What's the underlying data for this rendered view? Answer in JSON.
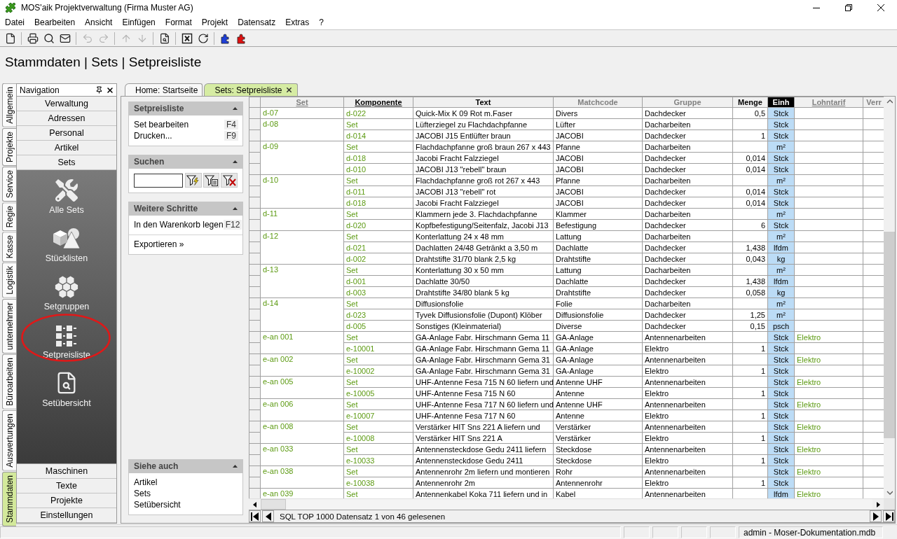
{
  "window": {
    "title": "MOS'aik Projektverwaltung (Firma Muster AG)"
  },
  "menu": [
    "Datei",
    "Bearbeiten",
    "Ansicht",
    "Einfügen",
    "Format",
    "Projekt",
    "Datensatz",
    "Extras",
    "?"
  ],
  "toolbar": [
    [
      {
        "disabled": false
      }
    ],
    [
      {
        "disabled": false
      },
      {
        "disabled": false
      },
      {
        "disabled": false
      }
    ],
    [
      {
        "disabled": true
      },
      {
        "disabled": true
      }
    ],
    [
      {
        "disabled": true
      },
      {
        "disabled": true
      }
    ],
    [
      {
        "disabled": false
      }
    ],
    [
      {
        "disabled": false
      },
      {
        "disabled": false
      }
    ],
    [
      {
        "disabled": false
      },
      {
        "disabled": false
      }
    ]
  ],
  "header": {
    "title": "Stammdaten | Sets | Setpreisliste"
  },
  "side_tabs": [
    {
      "label": "Allgemein",
      "selected": false
    },
    {
      "label": "Projekte",
      "selected": false
    },
    {
      "label": "Service",
      "selected": false
    },
    {
      "label": "Regie",
      "selected": false
    },
    {
      "label": "Kasse",
      "selected": false
    },
    {
      "label": "Logistik",
      "selected": false
    },
    {
      "label": "unternehmer",
      "selected": false
    },
    {
      "label": "Büroarbeiten",
      "selected": false
    },
    {
      "label": "Auswertungen",
      "selected": false
    },
    {
      "label": "Stammdaten",
      "selected": true
    }
  ],
  "navigation": {
    "title": "Navigation",
    "top_buttons": [
      "Verwaltung",
      "Adressen",
      "Personal",
      "Artikel",
      "Sets"
    ],
    "tiles": [
      {
        "label": "Alle Sets",
        "highlighted": false
      },
      {
        "label": "Stücklisten",
        "highlighted": false
      },
      {
        "label": "Setgruppen",
        "highlighted": false
      },
      {
        "label": "Setpreisliste",
        "highlighted": true
      },
      {
        "label": "Setübersicht",
        "highlighted": false
      }
    ],
    "bottom_buttons": [
      "Maschinen",
      "Texte",
      "Projekte",
      "Einstellungen"
    ]
  },
  "document_tabs": [
    {
      "label": "Home: Startseite",
      "selected": false,
      "closable": false
    },
    {
      "label": "Sets: Setpreisliste",
      "selected": true,
      "closable": true
    }
  ],
  "task_panel": {
    "sections": [
      {
        "kind": "links",
        "title": "Setpreisliste",
        "expanded": true,
        "groups": [
          [
            {
              "label": "Set bearbeiten",
              "shortcut": "F4"
            },
            {
              "label": "Drucken...",
              "shortcut": "F9"
            }
          ]
        ]
      },
      {
        "kind": "search",
        "title": "Suchen",
        "expanded": true
      },
      {
        "kind": "links",
        "title": "Weitere Schritte",
        "expanded": true,
        "groups": [
          [
            {
              "label": "In den Warenkorb legen",
              "shortcut": "F12"
            }
          ],
          [
            {
              "label": "Exportieren »"
            }
          ]
        ]
      }
    ],
    "see_also": {
      "kind": "links",
      "title": "Siehe auch",
      "expanded": true,
      "groups": [
        [
          {
            "label": "Artikel"
          },
          {
            "label": "Sets"
          },
          {
            "label": "Setübersicht"
          }
        ]
      ]
    }
  },
  "grid": {
    "columns": [
      {
        "label": "Set",
        "underlined": true,
        "dimmed": true,
        "selected": false
      },
      {
        "label": "Komponente",
        "underlined": true,
        "dimmed": false,
        "selected": false
      },
      {
        "label": "Text",
        "underlined": false,
        "dimmed": false,
        "selected": false
      },
      {
        "label": "Matchcode",
        "underlined": false,
        "dimmed": true,
        "selected": false
      },
      {
        "label": "Gruppe",
        "underlined": false,
        "dimmed": true,
        "selected": false
      },
      {
        "label": "Menge",
        "underlined": false,
        "dimmed": false,
        "selected": false
      },
      {
        "label": "Einh",
        "underlined": false,
        "dimmed": false,
        "selected": true
      },
      {
        "label": "Lohntarif",
        "underlined": true,
        "dimmed": true,
        "selected": false
      },
      {
        "label": "Verr",
        "underlined": false,
        "dimmed": true,
        "selected": false
      }
    ],
    "groups": [
      {
        "set": "d-07",
        "rows": [
          {
            "component": "d-022",
            "text": "Quick-Mix K 09 Rot m.Faser",
            "matchcode": "Divers",
            "group": "Dachdecker",
            "quantity": "0,5",
            "unit": "Stck"
          }
        ]
      },
      {
        "set": "d-08",
        "rows": [
          {
            "component": "Set",
            "text": "Lüfterziegel zu Flachdachpfanne",
            "matchcode": "Lüfter",
            "group": "Dacharbeiten",
            "unit": "Stck"
          },
          {
            "component": "d-014",
            "text": "JACOBI J15 Entlüfter braun",
            "matchcode": "JACOBI",
            "group": "Dachdecker",
            "quantity": "1",
            "unit": "Stck"
          }
        ]
      },
      {
        "set": "d-09",
        "rows": [
          {
            "component": "Set",
            "text": "Flachdachpfanne groß braun 267 x 443",
            "matchcode": "Pfanne",
            "group": "Dacharbeiten",
            "unit": "m²"
          },
          {
            "component": "d-018",
            "text": "Jacobi Fracht Falzziegel",
            "matchcode": "JACOBI",
            "group": "Dachdecker",
            "quantity": "0,014",
            "unit": "Stck"
          },
          {
            "component": "d-010",
            "text": "JACOBI J13 \"rebell\" braun",
            "matchcode": "JACOBI",
            "group": "Dachdecker",
            "quantity": "0,014",
            "unit": "Stck"
          }
        ]
      },
      {
        "set": "d-10",
        "rows": [
          {
            "component": "Set",
            "text": "Flachdachpfanne groß rot 267 x 443",
            "matchcode": "Pfanne",
            "group": "Dacharbeiten",
            "unit": "m²"
          },
          {
            "component": "d-011",
            "text": "JACOBI J13 \"rebell\" rot",
            "matchcode": "JACOBI",
            "group": "Dachdecker",
            "quantity": "0,014",
            "unit": "Stck"
          },
          {
            "component": "d-018",
            "text": "Jacobi Fracht Falzziegel",
            "matchcode": "JACOBI",
            "group": "Dachdecker",
            "quantity": "0,014",
            "unit": "Stck"
          }
        ]
      },
      {
        "set": "d-11",
        "rows": [
          {
            "component": "Set",
            "text": "Klammern jede 3. Flachdachpfanne",
            "matchcode": "Klammer",
            "group": "Dacharbeiten",
            "unit": "m²"
          },
          {
            "component": "d-020",
            "text": "Kopfbefestigung/Seitenfalz, Jacobi J13",
            "matchcode": "Befestigung",
            "group": "Dachdecker",
            "quantity": "6",
            "unit": "Stck"
          }
        ]
      },
      {
        "set": "d-12",
        "rows": [
          {
            "component": "Set",
            "text": "Konterlattung 24 x 48 mm",
            "matchcode": "Lattung",
            "group": "Dacharbeiten",
            "unit": "m²"
          },
          {
            "component": "d-021",
            "text": "Dachlatten 24/48 Getränkt a 3,50 m",
            "matchcode": "Dachlatte",
            "group": "Dachdecker",
            "quantity": "1,438",
            "unit": "lfdm"
          },
          {
            "component": "d-002",
            "text": "Drahtstifte 31/70 blank 2,5 kg",
            "matchcode": "Drahtstifte",
            "group": "Dachdecker",
            "quantity": "0,043",
            "unit": "kg"
          }
        ]
      },
      {
        "set": "d-13",
        "rows": [
          {
            "component": "Set",
            "text": "Konterlattung 30 x 50 mm",
            "matchcode": "Lattung",
            "group": "Dacharbeiten",
            "unit": "m²"
          },
          {
            "component": "d-001",
            "text": "Dachlatte 30/50",
            "matchcode": "Dachlatte",
            "group": "Dachdecker",
            "quantity": "1,438",
            "unit": "lfdm"
          },
          {
            "component": "d-003",
            "text": "Drahtstifte 34/80 blank 5 kg",
            "matchcode": "Drahtstifte",
            "group": "Dachdecker",
            "quantity": "0,058",
            "unit": "kg"
          }
        ]
      },
      {
        "set": "d-14",
        "rows": [
          {
            "component": "Set",
            "text": "Diffusionsfolie",
            "matchcode": "Folie",
            "group": "Dacharbeiten",
            "unit": "m²"
          },
          {
            "component": "d-023",
            "text": "Tyvek Diffusionsfolie (Dupont) Klöber",
            "matchcode": "Diffusionsfolie",
            "group": "Dachdecker",
            "quantity": "1,25",
            "unit": "m²"
          },
          {
            "component": "d-005",
            "text": "Sonstiges (Kleinmaterial)",
            "matchcode": "Diverse",
            "group": "Dachdecker",
            "quantity": "0,15",
            "unit": "psch"
          }
        ]
      },
      {
        "set": "e-an 001",
        "rows": [
          {
            "component": "Set",
            "text": "GA-Anlage Fabr. Hirschmann Gema 11",
            "matchcode": "GA-Anlage",
            "group": "Antennenarbeiten",
            "unit": "Stck",
            "wage_rate": "Elektro"
          },
          {
            "component": "e-10001",
            "text": "GA-Anlage Fabr. Hirschmann Gema 11",
            "matchcode": "GA-Anlage",
            "group": "Elektro",
            "quantity": "1",
            "unit": "Stck"
          }
        ]
      },
      {
        "set": "e-an 002",
        "rows": [
          {
            "component": "Set",
            "text": "GA-Anlage Fabr. Hirschmann Gema 31",
            "matchcode": "GA-Anlage",
            "group": "Antennenarbeiten",
            "unit": "Stck",
            "wage_rate": "Elektro"
          },
          {
            "component": "e-10002",
            "text": "GA-Anlage Fabr. Hirschmann Gema 31",
            "matchcode": "GA-Anlage",
            "group": "Elektro",
            "quantity": "1",
            "unit": "Stck"
          }
        ]
      },
      {
        "set": "e-an 005",
        "rows": [
          {
            "component": "Set",
            "text": "UHF-Antenne Fesa 715 N 60 liefern und",
            "matchcode": "Antenne UHF",
            "group": "Antennenarbeiten",
            "unit": "Stck",
            "wage_rate": "Elektro"
          },
          {
            "component": "e-10005",
            "text": "UHF-Antenne Fesa 715 N 60",
            "matchcode": "Antenne",
            "group": "Elektro",
            "quantity": "1",
            "unit": "Stck"
          }
        ]
      },
      {
        "set": "e-an 006",
        "rows": [
          {
            "component": "Set",
            "text": "UHF-Antenne Fesa 717 N 60 liefern und",
            "matchcode": "Antenne UHF",
            "group": "Antennenarbeiten",
            "unit": "Stck",
            "wage_rate": "Elektro"
          },
          {
            "component": "e-10007",
            "text": "UHF-Antenne Fesa 717 N 60",
            "matchcode": "Antenne",
            "group": "Elektro",
            "quantity": "1",
            "unit": "Stck"
          }
        ]
      },
      {
        "set": "e-an 008",
        "rows": [
          {
            "component": "Set",
            "text": "Verstärker HIT Sns 221 A liefern und",
            "matchcode": "Verstärker",
            "group": "Antennenarbeiten",
            "unit": "Stck",
            "wage_rate": "Elektro"
          },
          {
            "component": "e-10008",
            "text": "Verstärker HIT Sns 221 A",
            "matchcode": "Verstärker",
            "group": "Elektro",
            "quantity": "1",
            "unit": "Stck"
          }
        ]
      },
      {
        "set": "e-an 033",
        "rows": [
          {
            "component": "Set",
            "text": "Antennensteckdose Gedu 2411 liefern",
            "matchcode": "Steckdose",
            "group": "Antennenarbeiten",
            "unit": "Stck",
            "wage_rate": "Elektro"
          },
          {
            "component": "e-10033",
            "text": "Antennensteckdose Gedu 2411",
            "matchcode": "Steckdose",
            "group": "Elektro",
            "quantity": "1",
            "unit": "Stck"
          }
        ]
      },
      {
        "set": "e-an 038",
        "rows": [
          {
            "component": "Set",
            "text": "Antennenrohr 2m liefern und montieren",
            "matchcode": "Rohr",
            "group": "Antennenarbeiten",
            "unit": "Stck",
            "wage_rate": "Elektro"
          },
          {
            "component": "e-10038",
            "text": "Antennenrohr 2m",
            "matchcode": "Antennenrohr",
            "group": "Elektro",
            "quantity": "1",
            "unit": "Stck"
          }
        ]
      },
      {
        "set": "e-an 039",
        "rows": [
          {
            "component": "Set",
            "text": "Antennenkabel Koka 711 liefern und in",
            "matchcode": "Kabel",
            "group": "Antennenarbeiten",
            "unit": "lfdm",
            "wage_rate": "Elektro"
          }
        ]
      }
    ]
  },
  "record_navigator": {
    "text": "SQL TOP 1000 Datensatz 1 von 46 gelesenen"
  },
  "status_bar": {
    "text": "admin - Moser-Dokumentation.mdb"
  }
}
